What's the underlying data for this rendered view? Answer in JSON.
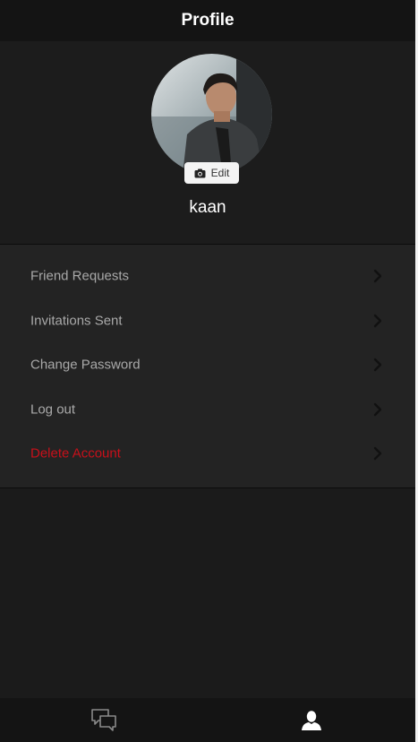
{
  "header": {
    "title": "Profile"
  },
  "profile": {
    "edit_label": "Edit",
    "username": "kaan"
  },
  "menu": {
    "items": [
      {
        "label": "Friend Requests"
      },
      {
        "label": "Invitations Sent"
      },
      {
        "label": "Change Password"
      },
      {
        "label": "Log out"
      },
      {
        "label": "Delete Account"
      }
    ]
  },
  "tabbar": {
    "tabs": [
      {
        "icon": "chat-bubbles-icon"
      },
      {
        "icon": "user-icon"
      }
    ]
  },
  "colors": {
    "background": "#1b1b1b",
    "header": "#141414",
    "menu_background": "#232323",
    "danger": "#c8101a",
    "menu_text": "#a9a9a9"
  }
}
